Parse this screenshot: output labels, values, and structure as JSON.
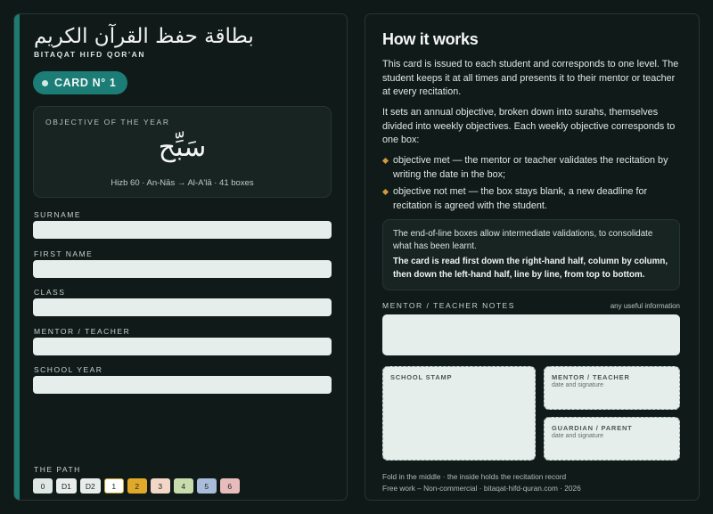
{
  "left": {
    "arabic_title": "بطاقة حفظ القرآن الكريم",
    "latin_title": "BITAQAT HIFD QOR'AN",
    "card_label": "CARD N° 1",
    "objective": {
      "title": "OBJECTIVE OF THE YEAR",
      "arabic": "سَبِّح",
      "description": "Hizb 60 · An-Nās → Al-A'lā · 41 boxes"
    },
    "fields": [
      {
        "label": "SURNAME",
        "value": ""
      },
      {
        "label": "FIRST NAME",
        "value": ""
      },
      {
        "label": "CLASS",
        "value": ""
      },
      {
        "label": "MENTOR / TEACHER",
        "value": ""
      },
      {
        "label": "SCHOOL YEAR",
        "value": ""
      }
    ],
    "path_label": "THE PATH",
    "path": [
      {
        "label": "0",
        "color": "#dfe6e4"
      },
      {
        "label": "D1",
        "color": "#e8edec"
      },
      {
        "label": "D2",
        "color": "#e8edec"
      },
      {
        "label": "1",
        "color": "#ffffff"
      },
      {
        "label": "2",
        "color": "#e1a92a"
      },
      {
        "label": "3",
        "color": "#f3d6c6"
      },
      {
        "label": "4",
        "color": "#c9dcae"
      },
      {
        "label": "5",
        "color": "#a9bcd9"
      },
      {
        "label": "6",
        "color": "#e9bcbc"
      }
    ]
  },
  "right": {
    "title": "How it works",
    "para1": "This card is issued to each student and corresponds to one level. The student keeps it at all times and presents it to their mentor or teacher at every recitation.",
    "para2": "It sets an annual objective, broken down into surahs, themselves divided into weekly objectives. Each weekly objective corresponds to one box:",
    "bullets": [
      "objective met — the mentor or teacher validates the recitation by writing the date in the box;",
      "objective not met — the box stays blank, a new deadline for recitation is agreed with the student."
    ],
    "info_normal": "The end-of-line boxes allow intermediate validations, to consolidate what has been learnt.",
    "info_bold": "The card is read first down the right-hand half, column by column, then down the left-hand half, line by line, from top to bottom.",
    "notes_label": "MENTOR / TEACHER NOTES",
    "notes_hint": "any useful information",
    "stamp_school": "SCHOOL STAMP",
    "stamp_mentor": "MENTOR / TEACHER",
    "stamp_mentor_sub": "date and signature",
    "stamp_guardian": "GUARDIAN / PARENT",
    "stamp_guardian_sub": "date and signature",
    "footer1": "Fold in the middle · the inside holds the recitation record",
    "footer2": "Free work – Non-commercial · bitaqat-hifd-quran.com · 2026"
  },
  "colors": {
    "background": "#0f1a18",
    "accent_teal": "#1c7d76",
    "bullet_gold": "#d19a3a",
    "field_fill": "#e6eeec"
  }
}
